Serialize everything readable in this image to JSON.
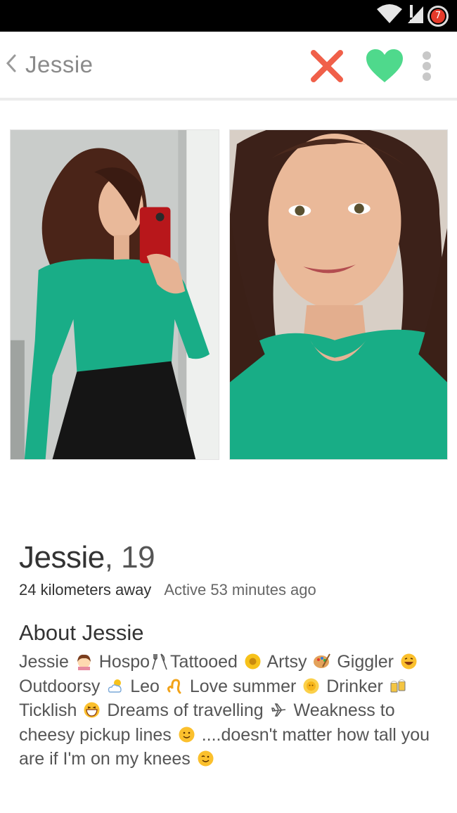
{
  "status_bar": {
    "notification_count": "7"
  },
  "app_bar": {
    "back_label": "Jessie"
  },
  "profile": {
    "name": "Jessie",
    "age_text": ", 19",
    "distance": "24 kilometers away",
    "active": "Active 53 minutes ago",
    "about_title": "About Jessie"
  },
  "bio": {
    "t1": "Jessie",
    "t2": "Hospo",
    "t3": "Tattooed",
    "t4": "Artsy",
    "t5": "Giggler",
    "t6": "Outdoorsy",
    "t7": "Leo",
    "t8": "Love summer",
    "t9": "Drinker",
    "t10": "Ticklish",
    "t11": "Dreams of travelling",
    "t12": "Weakness to cheesy pickup lines",
    "t13": "....doesn't matter how tall you are if I'm on my knees"
  },
  "colors": {
    "dislike": "#f0604a",
    "like": "#4fd98c",
    "top_green": "#16a37e"
  }
}
